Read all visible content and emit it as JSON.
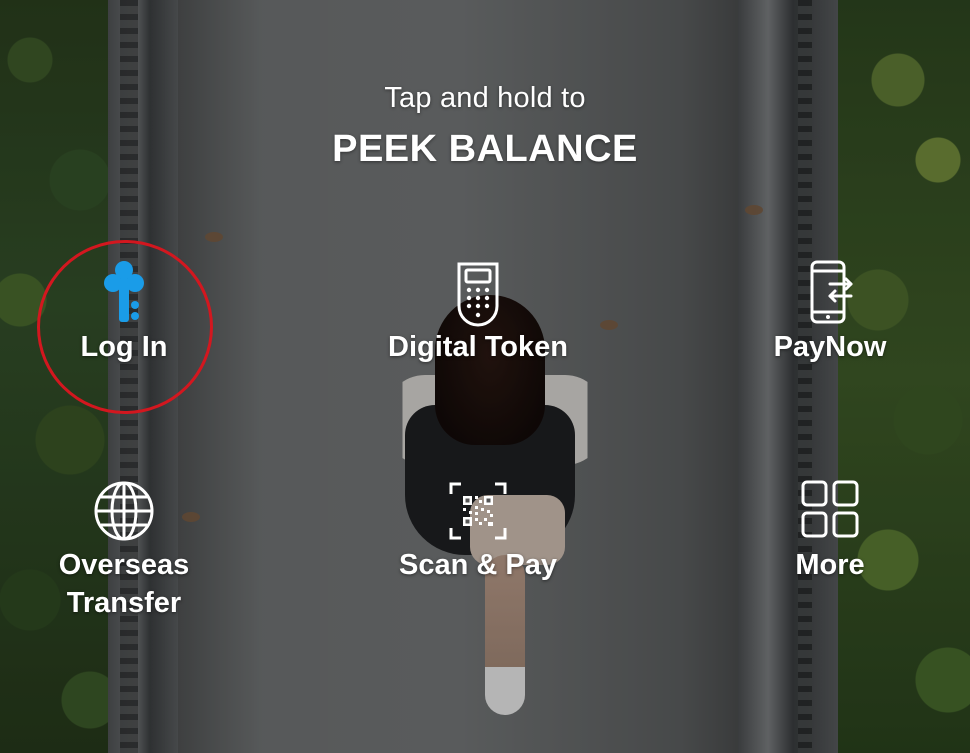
{
  "peek": {
    "subtitle": "Tap and hold to",
    "title": "PEEK BALANCE"
  },
  "actions": [
    {
      "label": "Log In",
      "icon": "key-icon",
      "color": "#1a9ce8"
    },
    {
      "label": "Digital Token",
      "icon": "digital-token-icon",
      "color": "#ffffff"
    },
    {
      "label": "PayNow",
      "icon": "phone-transfer-icon",
      "color": "#ffffff"
    },
    {
      "label": "Overseas\nTransfer",
      "icon": "globe-icon",
      "color": "#ffffff"
    },
    {
      "label": "Scan & Pay",
      "icon": "qr-scan-icon",
      "color": "#ffffff"
    },
    {
      "label": "More",
      "icon": "grid-icon",
      "color": "#ffffff"
    }
  ],
  "highlight_color": "#d3171f"
}
